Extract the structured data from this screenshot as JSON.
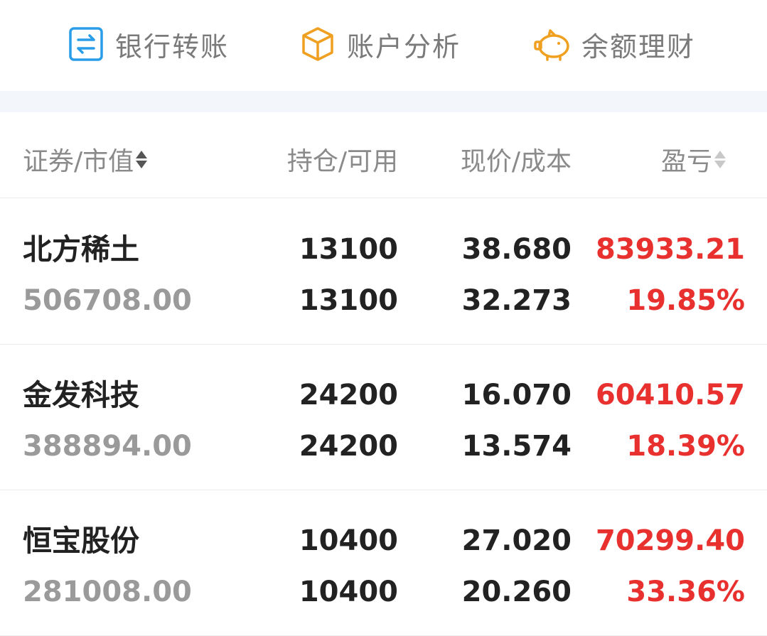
{
  "actions": [
    {
      "label": "银行转账",
      "icon": "bank-transfer-icon",
      "color": "#2a9de8"
    },
    {
      "label": "账户分析",
      "icon": "cube-icon",
      "color": "#f0a020"
    },
    {
      "label": "余额理财",
      "icon": "piggy-bank-icon",
      "color": "#f0a020"
    }
  ],
  "table": {
    "headers": {
      "security": "证券/市值",
      "position": "持仓/可用",
      "price": "现价/成本",
      "pl": "盈亏"
    },
    "rows": [
      {
        "name": "北方稀土",
        "market_value": "506708.00",
        "holding": "13100",
        "available": "13100",
        "price": "38.680",
        "cost": "32.273",
        "pl": "83933.21",
        "pl_pct": "19.85%"
      },
      {
        "name": "金发科技",
        "market_value": "388894.00",
        "holding": "24200",
        "available": "24200",
        "price": "16.070",
        "cost": "13.574",
        "pl": "60410.57",
        "pl_pct": "18.39%"
      },
      {
        "name": "恒宝股份",
        "market_value": "281008.00",
        "holding": "10400",
        "available": "10400",
        "price": "27.020",
        "cost": "20.260",
        "pl": "70299.40",
        "pl_pct": "33.36%"
      }
    ]
  },
  "colors": {
    "profit": "#e8302f",
    "primary_text": "#222222",
    "secondary_text": "#9a9a9a"
  }
}
